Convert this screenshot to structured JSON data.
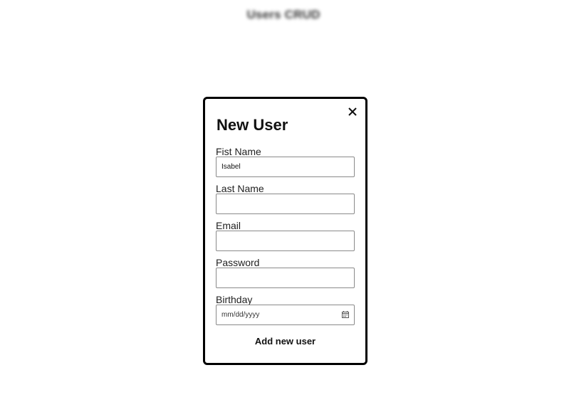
{
  "app": {
    "title": "Users CRUD"
  },
  "modal": {
    "title": "New User",
    "close_icon": "close-icon",
    "fields": {
      "first_name": {
        "label": "Fist Name",
        "value": "Isabel"
      },
      "last_name": {
        "label": "Last Name",
        "value": ""
      },
      "email": {
        "label": "Email",
        "value": ""
      },
      "password": {
        "label": "Password",
        "value": ""
      },
      "birthday": {
        "label": "Birthday",
        "placeholder": "mm/dd/yyyy",
        "icon": "calendar-icon"
      }
    },
    "submit_label": "Add new user"
  }
}
